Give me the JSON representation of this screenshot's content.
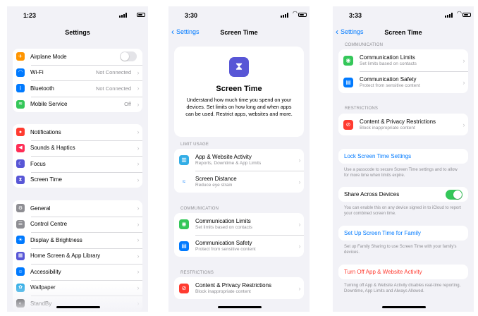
{
  "colors": {
    "orange": "#ff9500",
    "blue": "#007aff",
    "green": "#34c759",
    "purple": "#5856d6",
    "red": "#ff3b30",
    "pink": "#ff2d55",
    "gray": "#8e8e93",
    "teal": "#32ade6",
    "black": "#1c1c1e"
  },
  "screen1": {
    "time": "1:23",
    "title": "Settings",
    "group1": [
      {
        "label": "Airplane Mode",
        "icon": "airplane-icon"
      },
      {
        "label": "Wi-Fi",
        "value": "Not Connected",
        "icon": "wifi-icon"
      },
      {
        "label": "Bluetooth",
        "value": "Not Connected",
        "icon": "bluetooth-icon"
      },
      {
        "label": "Mobile Service",
        "value": "Off",
        "icon": "antenna-icon"
      }
    ],
    "group2": [
      {
        "label": "Notifications",
        "icon": "bell-icon"
      },
      {
        "label": "Sounds & Haptics",
        "icon": "speaker-icon"
      },
      {
        "label": "Focus",
        "icon": "moon-icon"
      },
      {
        "label": "Screen Time",
        "icon": "hourglass-icon"
      }
    ],
    "group3": [
      {
        "label": "General",
        "icon": "gear-icon"
      },
      {
        "label": "Control Centre",
        "icon": "control-centre-icon"
      },
      {
        "label": "Display & Brightness",
        "icon": "sun-icon"
      },
      {
        "label": "Home Screen & App Library",
        "icon": "home-screen-icon"
      },
      {
        "label": "Accessibility",
        "icon": "accessibility-icon"
      },
      {
        "label": "Wallpaper",
        "icon": "flower-icon"
      },
      {
        "label": "StandBy",
        "icon": "standby-icon"
      }
    ]
  },
  "screen2": {
    "time": "3:30",
    "back": "Settings",
    "title": "Screen Time",
    "hero_title": "Screen Time",
    "hero_desc": "Understand how much time you spend on your devices. Set limits on how long and when apps can be used. Restrict apps, websites and more.",
    "section_limit": "LIMIT USAGE",
    "limit_rows": [
      {
        "title": "App & Website Activity",
        "subtitle": "Reports, Downtime & App Limits",
        "icon": "chart-icon"
      },
      {
        "title": "Screen Distance",
        "subtitle": "Reduce eye strain",
        "icon": "screen-distance-icon"
      }
    ],
    "section_comm": "COMMUNICATION",
    "comm_rows": [
      {
        "title": "Communication Limits",
        "subtitle": "Set limits based on contacts",
        "icon": "person-icon"
      },
      {
        "title": "Communication Safety",
        "subtitle": "Protect from sensitive content",
        "icon": "chat-bubble-icon"
      }
    ],
    "section_restr": "RESTRICTIONS",
    "restr_rows": [
      {
        "title": "Content & Privacy Restrictions",
        "subtitle": "Block inappropriate content",
        "icon": "no-entry-icon"
      }
    ]
  },
  "screen3": {
    "time": "3:33",
    "back": "Settings",
    "title": "Screen Time",
    "section_comm": "COMMUNICATION",
    "comm_rows": [
      {
        "title": "Communication Limits",
        "subtitle": "Set limits based on contacts",
        "icon": "person-icon"
      },
      {
        "title": "Communication Safety",
        "subtitle": "Protect from sensitive content",
        "icon": "chat-bubble-icon"
      }
    ],
    "section_restr": "RESTRICTIONS",
    "restr_rows": [
      {
        "title": "Content & Privacy Restrictions",
        "subtitle": "Block inappropriate content",
        "icon": "no-entry-icon"
      }
    ],
    "lock_label": "Lock Screen Time Settings",
    "lock_note": "Use a passcode to secure Screen Time settings and to allow for more time when limits expire.",
    "share_label": "Share Across Devices",
    "share_on": true,
    "share_note": "You can enable this on any device signed in to iCloud to report your combined screen time.",
    "family_label": "Set Up Screen Time for Family",
    "family_note": "Set up Family Sharing to use Screen Time with your family's devices.",
    "turnoff_label": "Turn Off App & Website Activity",
    "turnoff_note": "Turning off App & Website Activity disables real-time reporting, Downtime, App Limits and Always Allowed."
  }
}
